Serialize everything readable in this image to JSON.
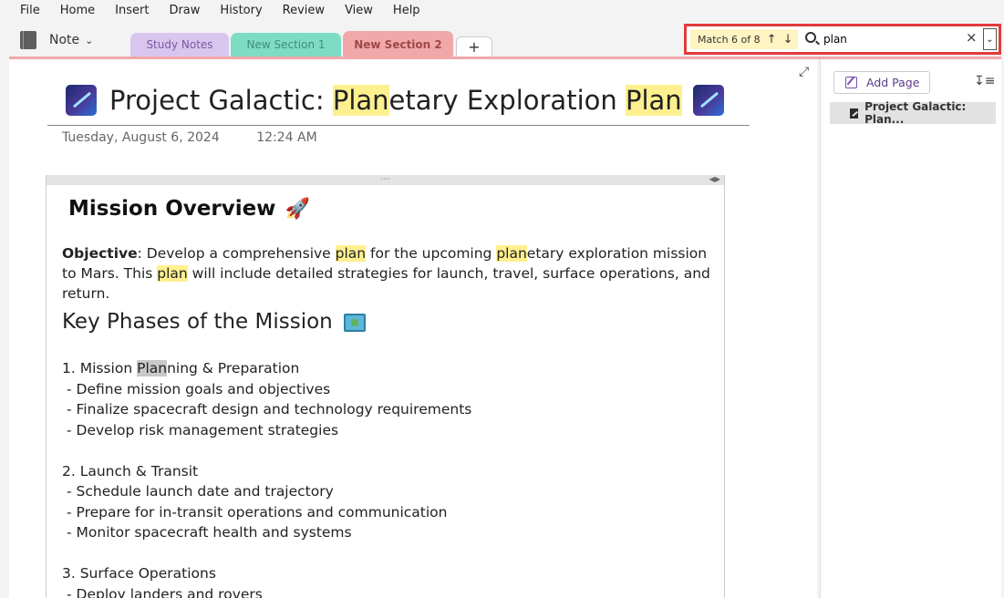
{
  "menu": [
    "File",
    "Home",
    "Insert",
    "Draw",
    "History",
    "Review",
    "View",
    "Help"
  ],
  "notebook": {
    "label": "Note",
    "icon": "notebook-icon"
  },
  "sections": [
    {
      "label": "Study Notes",
      "color": "#d9c6ef"
    },
    {
      "label": "New Section 1",
      "color": "#7fdcc4"
    },
    {
      "label": "New Section 2",
      "color": "#f0a8a8",
      "active": true
    }
  ],
  "add_section": "+",
  "search": {
    "match_label": "Match 6 of 8",
    "up": "↑",
    "down": "↓",
    "query": "plan",
    "clear": "×",
    "dropdown": "⌄"
  },
  "page": {
    "title_pre": "Project Galactic: ",
    "title_hl1": "Plan",
    "title_mid": "etary Exploration ",
    "title_hl2": "Plan",
    "date": "Tuesday, August 6, 2024",
    "time": "12:24 AM",
    "handle_dots": "····",
    "mission_heading": "Mission Overview",
    "rocket": "🚀",
    "objective": {
      "label": "Objective",
      "t1": ": Develop a comprehensive ",
      "hl1": "plan",
      "t2": " for the upcoming ",
      "hl2": "plan",
      "t3": "etary exploration mission to Mars. This ",
      "hl3": "plan",
      "t4": " will include detailed strategies for launch, travel, surface operations, and return."
    },
    "phases_heading": "Key Phases of the Mission",
    "phase1": {
      "pre": "1. Mission ",
      "hl": "Plan",
      "post": "ning & Preparation"
    },
    "phase1_items": [
      "- Define mission goals and objectives",
      "- Finalize spacecraft design and technology requirements",
      "- Develop risk management strategies"
    ],
    "phase2": "2. Launch & Transit",
    "phase2_items": [
      "- Schedule launch date and trajectory",
      "- Prepare for in-transit operations and communication",
      "- Monitor spacecraft health and systems"
    ],
    "phase3": "3. Surface Operations",
    "phase3_items": [
      "- Deploy landers and rovers"
    ]
  },
  "panel": {
    "add_page": "Add Page",
    "page_title": "Project Galactic: Plan..."
  }
}
